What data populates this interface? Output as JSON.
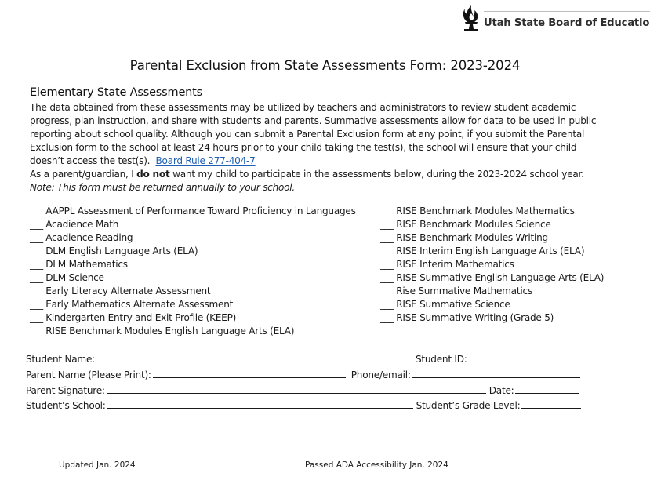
{
  "header": {
    "logo_text": "Utah State Board of Education",
    "logo_icon": "flame-torch-icon"
  },
  "title": "Parental Exclusion from State Assessments Form: 2023-2024",
  "section_heading": "Elementary State Assessments",
  "intro": {
    "paragraph": "The data obtained from these assessments may be utilized by teachers and administrators to review student academic progress, plan instruction, and share with students and parents. Summative assessments allow for data to be used in public reporting about school quality. Although you can submit a Parental Exclusion form at any point, if you submit the Parental Exclusion form to the school at least 24 hours prior to your child taking the test(s), the school will ensure that your child doesn’t access the test(s).",
    "link_text": "Board Rule 277-404-7",
    "statement_prefix": "As a parent/guardian, I ",
    "statement_emphasis": "do not",
    "statement_suffix": " want my child to participate in the assessments below, during the 2023-2024 school year.",
    "note": "Note: This form must be returned annually to your school.",
    "link_color": "#1f5fb4"
  },
  "blank_marker": "___",
  "assessments_left": [
    "AAPPL Assessment of Performance Toward Proficiency in Languages",
    "Acadience Math",
    "Acadience Reading",
    "DLM English Language Arts (ELA)",
    "DLM Mathematics",
    "DLM Science",
    "Early Literacy Alternate Assessment",
    "Early Mathematics Alternate Assessment",
    "Kindergarten Entry and Exit Profile (KEEP)",
    "RISE Benchmark Modules English Language Arts (ELA)"
  ],
  "assessments_right": [
    "RISE Benchmark Modules Mathematics",
    "RISE Benchmark Modules Science",
    "RISE Benchmark Modules Writing",
    "RISE Interim English Language Arts (ELA)",
    "RISE Interim Mathematics",
    "RISE Summative English Language Arts (ELA)",
    "Rise Summative Mathematics",
    "RISE Summative Science",
    "RISE Summative Writing (Grade 5)"
  ],
  "fields": {
    "student_name": "Student Name:",
    "student_id": "Student ID:",
    "parent_name": "Parent Name (Please Print):",
    "phone_email": "Phone/email:",
    "parent_signature": "Parent Signature:",
    "date": "Date:",
    "students_school": "Student’s School:",
    "grade_level": "Student’s Grade Level:"
  },
  "footer": {
    "updated": "Updated Jan. 2024",
    "accessibility": "Passed ADA Accessibility Jan. 2024"
  }
}
